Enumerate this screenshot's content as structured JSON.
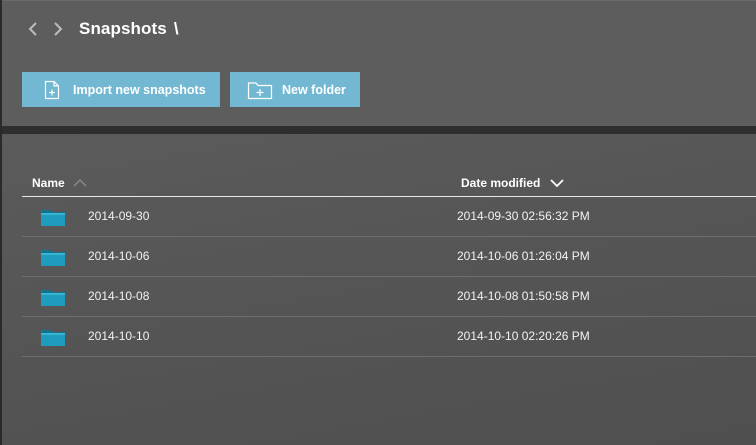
{
  "header": {
    "breadcrumb_title": "Snapshots",
    "breadcrumb_separator": "\\",
    "back_icon": "chevron-left-icon",
    "forward_icon": "chevron-right-icon"
  },
  "toolbar": {
    "import_label": "Import new snapshots",
    "import_icon": "file-add-icon",
    "new_folder_label": "New folder",
    "new_folder_icon": "folder-add-icon"
  },
  "list": {
    "columns": {
      "name": "Name",
      "date_modified": "Date modified"
    },
    "sort": {
      "column": "date_modified",
      "direction": "descending"
    },
    "rows": [
      {
        "name": "2014-09-30",
        "date": "2014-09-30 02:56:32 PM",
        "icon": "folder-icon"
      },
      {
        "name": "2014-10-06",
        "date": "2014-10-06 01:26:04 PM",
        "icon": "folder-icon"
      },
      {
        "name": "2014-10-08",
        "date": "2014-10-08 01:50:58 PM",
        "icon": "folder-icon"
      },
      {
        "name": "2014-10-10",
        "date": "2014-10-10 02:20:26 PM",
        "icon": "folder-icon"
      }
    ]
  },
  "colors": {
    "accent_button": "#73b8d2",
    "folder": "#1f9bbd",
    "top_panel": "#5d5d5d",
    "content_panel": "#555555"
  }
}
